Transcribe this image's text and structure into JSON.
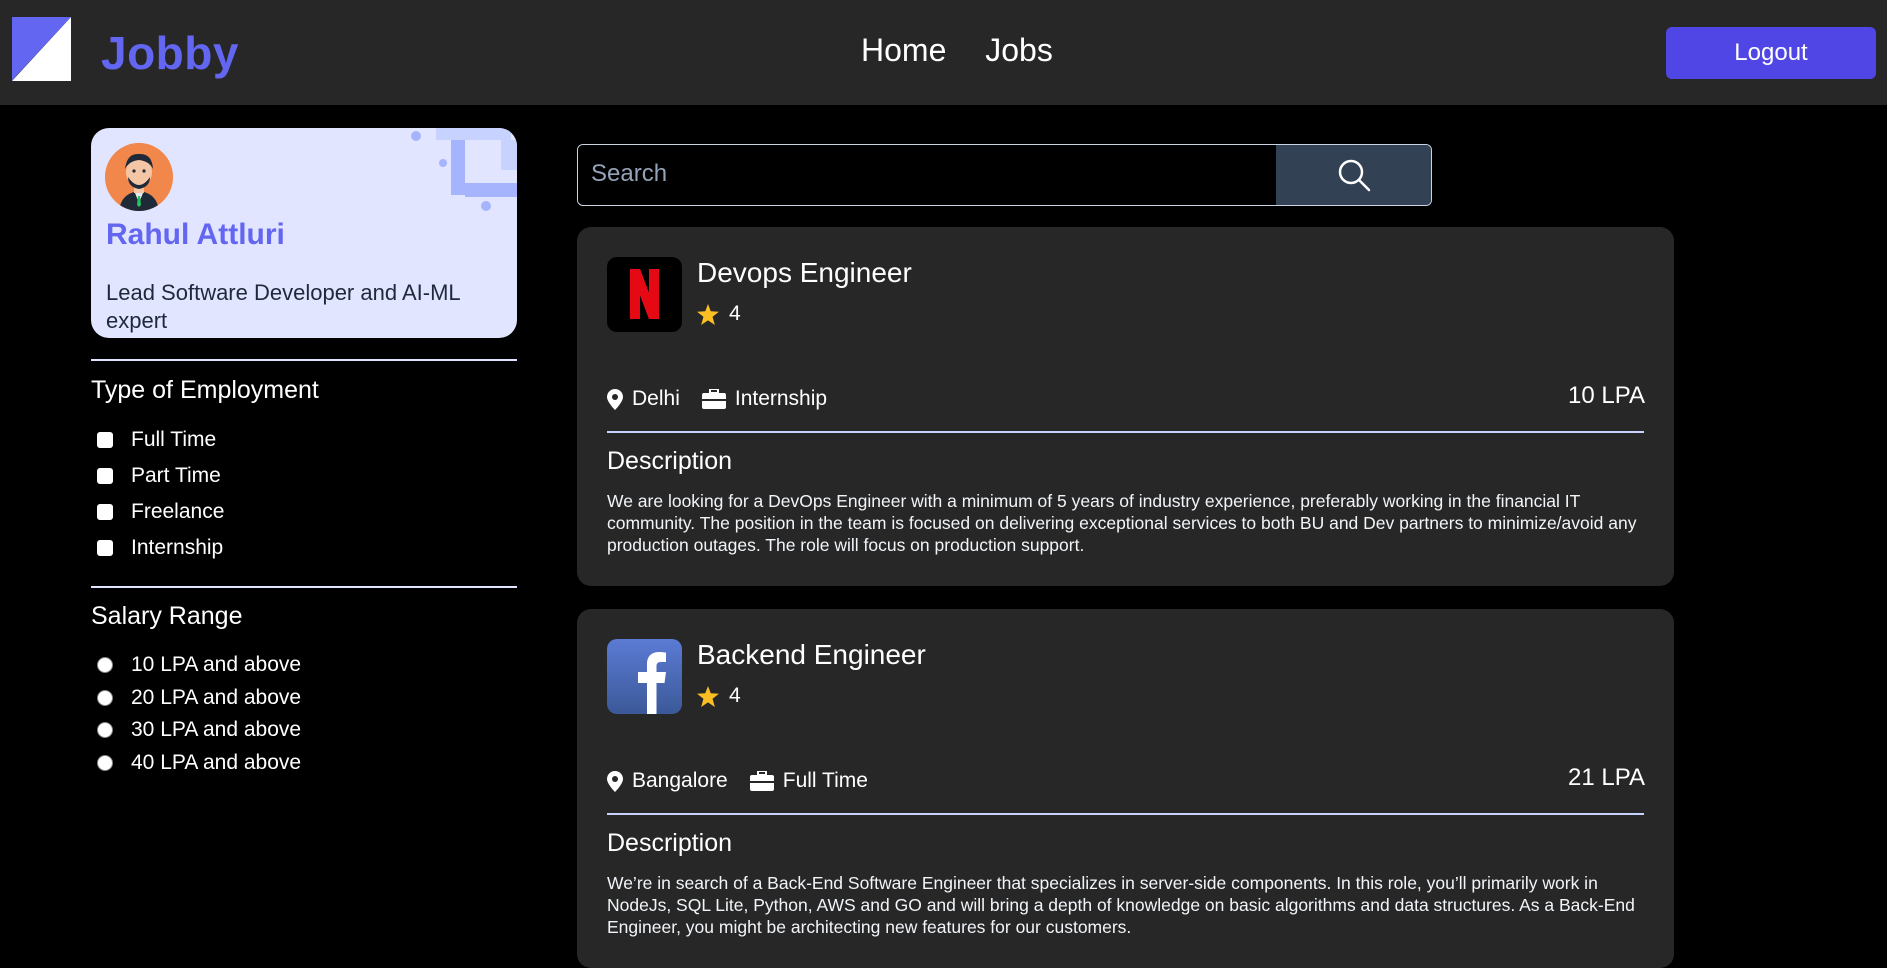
{
  "header": {
    "logo_text": "Jobby",
    "nav": [
      "Home",
      "Jobs"
    ],
    "logout_label": "Logout"
  },
  "profile": {
    "name": "Rahul Attluri",
    "bio": "Lead Software Developer and AI-ML expert"
  },
  "filters": {
    "employment_title": "Type of Employment",
    "employment_options": [
      "Full Time",
      "Part Time",
      "Freelance",
      "Internship"
    ],
    "salary_title": "Salary Range",
    "salary_options": [
      "10 LPA and above",
      "20 LPA and above",
      "30 LPA and above",
      "40 LPA and above"
    ]
  },
  "search": {
    "placeholder": "Search"
  },
  "jobs": [
    {
      "company_icon": "netflix-logo",
      "title": "Devops Engineer",
      "rating": "4",
      "location": "Delhi",
      "employment_type": "Internship",
      "package": "10 LPA",
      "description_heading": "Description",
      "description": "We are looking for a DevOps Engineer with a minimum of 5 years of industry experience, preferably working in the financial IT community. The position in the team is focused on delivering exceptional services to both BU and Dev partners to minimize/avoid any production outages. The role will focus on production support."
    },
    {
      "company_icon": "facebook-logo",
      "title": "Backend Engineer",
      "rating": "4",
      "location": "Bangalore",
      "employment_type": "Full Time",
      "package": "21 LPA",
      "description_heading": "Description",
      "description": "We’re in search of a Back-End Software Engineer that specializes in server-side components. In this role, you’ll primarily work in NodeJs, SQL Lite, Python, AWS and GO and will bring a depth of knowledge on basic algorithms and data structures. As a Back-End Engineer, you might be architecting new features for our customers."
    }
  ],
  "colors": {
    "accent": "#6366f1",
    "header_bg": "#272727",
    "card_bg": "#272727",
    "logout_bg": "#4f46e5",
    "star": "#fbbf24"
  }
}
